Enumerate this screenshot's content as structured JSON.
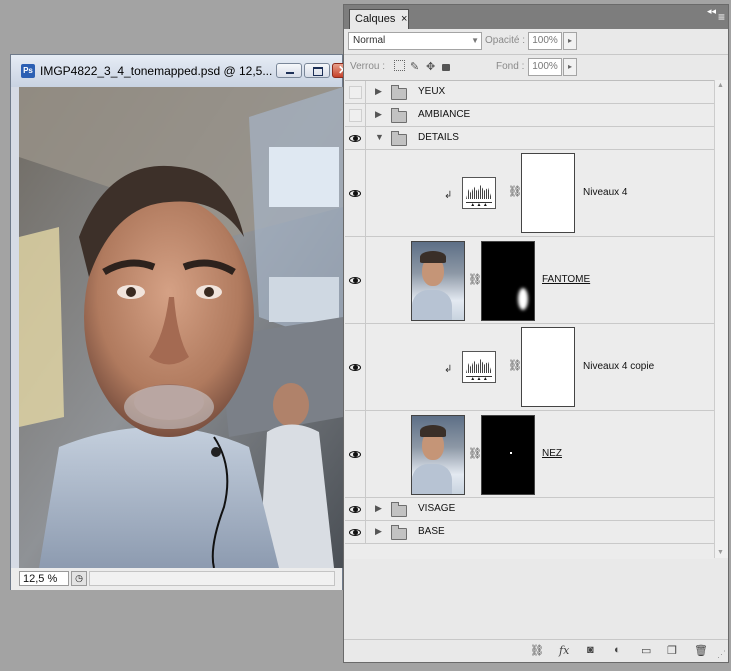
{
  "document": {
    "title": "IMGP4822_3_4_tonemapped.psd @ 12,5...",
    "app_icon_label": "Ps",
    "zoom": "12,5 %"
  },
  "layers_panel": {
    "tab_label": "Calques",
    "tab_close": "×",
    "blend_mode": "Normal",
    "opacity_label": "Opacité :",
    "opacity_value": "100%",
    "lock_label": "Verrou :",
    "fill_label": "Fond :",
    "fill_value": "100%",
    "groups": {
      "yeux": "YEUX",
      "ambiance": "AMBIANCE",
      "details": "DETAILS",
      "visage": "VISAGE",
      "base": "BASE"
    },
    "layers": {
      "niveaux4": "Niveaux 4",
      "fantome": "FANTOME",
      "niveaux4_copie": "Niveaux 4 copie",
      "nez": "NEZ"
    }
  }
}
